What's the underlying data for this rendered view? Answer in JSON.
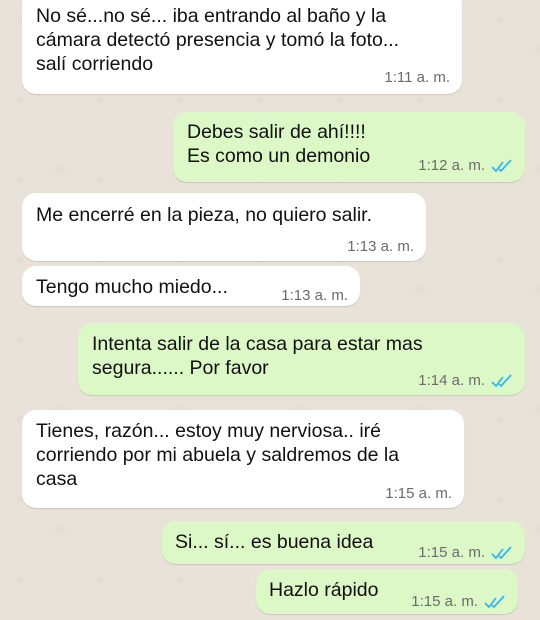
{
  "messages": [
    {
      "direction": "in",
      "text": "No sé...no sé... iba entrando al baño y la\ncámara detectó presencia y tomó la foto...\nsalí corriendo",
      "time": "1:11 a. m."
    },
    {
      "direction": "out",
      "text": "Debes salir de ahí!!!!\nEs como un demonio",
      "time": "1:12 a. m.",
      "status": "read-ticks-icon"
    },
    {
      "direction": "in",
      "text": "Me encerré en la pieza, no quiero salir.",
      "time": "1:13 a. m."
    },
    {
      "direction": "in",
      "text": "Tengo mucho miedo...",
      "time": "1:13 a. m."
    },
    {
      "direction": "out",
      "text": "Intenta salir de la casa para estar mas\nsegura...... Por favor",
      "time": "1:14 a. m.",
      "status": "read-ticks-icon"
    },
    {
      "direction": "in",
      "text": "Tienes, razón... estoy muy nerviosa.. iré\ncorriendo por mi abuela y saldremos de la\ncasa",
      "time": "1:15 a. m."
    },
    {
      "direction": "out",
      "text": "Si... sí... es buena idea",
      "time": "1:15 a. m.",
      "status": "read-ticks-icon"
    },
    {
      "direction": "out",
      "text": "Hazlo rápido",
      "time": "1:15 a. m.",
      "status": "read-ticks-icon"
    }
  ],
  "colors": {
    "incoming": "#ffffff",
    "outgoing": "#dcf8c6",
    "read_ticks": "#34b7f1",
    "timestamp": "#6b6b6b"
  }
}
